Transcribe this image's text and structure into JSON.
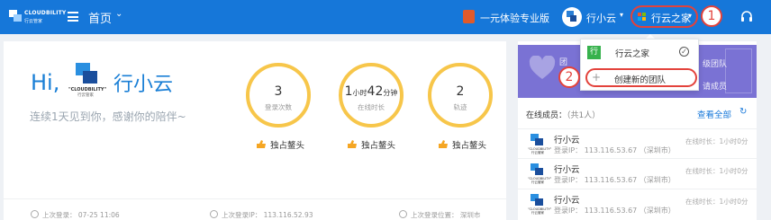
{
  "header": {
    "brand": "CLOUDBILITY",
    "brand_sub": "行云管家",
    "home_title": "首页",
    "pro_label": "一元体验专业版",
    "user_name": "行小云",
    "team_name": "行云之家",
    "step1": "1"
  },
  "dropdown": {
    "team_tag": "行",
    "current_team": "行云之家",
    "create_team": "创建新的团队",
    "step2": "2"
  },
  "welcome": {
    "hi": "Hi,",
    "avatar_brand": "\"CLOUDBILITY\"",
    "avatar_sub": "行云管家",
    "name": "行小云",
    "greeting": "连续1天见到你，感谢你的陪伴~"
  },
  "stats": [
    {
      "value": "3",
      "label": "登录次数"
    },
    {
      "value_hours": "1",
      "unit_hours": "小时",
      "value_minutes": "42",
      "unit_minutes": "分钟",
      "label": "在线时长"
    },
    {
      "value": "2",
      "label": "轨迹"
    }
  ],
  "awards": [
    "独占鳌头",
    "独占鳌头",
    "独占鳌头"
  ],
  "footer": {
    "last_login_time": "上次登录： 07-25 11:06",
    "last_login_ip": "上次登录IP： 113.116.52.93",
    "last_login_location": "上次登录位置： 深圳市"
  },
  "banner": {
    "text_left": "团",
    "text_right_top": "级团队",
    "text_right_bottom": "请成员"
  },
  "online": {
    "title": "在线成员：",
    "count": "（共1人）",
    "view_all": "查看全部",
    "refresh_icon": "refresh-icon"
  },
  "members": [
    {
      "avatar_label": "\"CLOUDBILITY\" 行云管家",
      "name": "行小云",
      "ip": "登录IP： 113.116.53.67 （深圳市）",
      "time": "在线时长：1小时0分"
    },
    {
      "avatar_label": "\"CLOUDBILITY\" 行云管家",
      "name": "行小云",
      "ip": "登录IP： 113.116.53.67 （深圳市）",
      "time": "在线时长：1小时0分"
    },
    {
      "avatar_label": "\"CLOUDBILITY\" 行云管家",
      "name": "行小云",
      "ip": "登录IP： 113.116.53.67 （深圳市）",
      "time": "在线时长：1小时0分"
    }
  ],
  "colors": {
    "topbar": "#1677d9",
    "highlight": "#e3423b",
    "ring": "#f7c64a",
    "banner": "#7a72d4"
  }
}
